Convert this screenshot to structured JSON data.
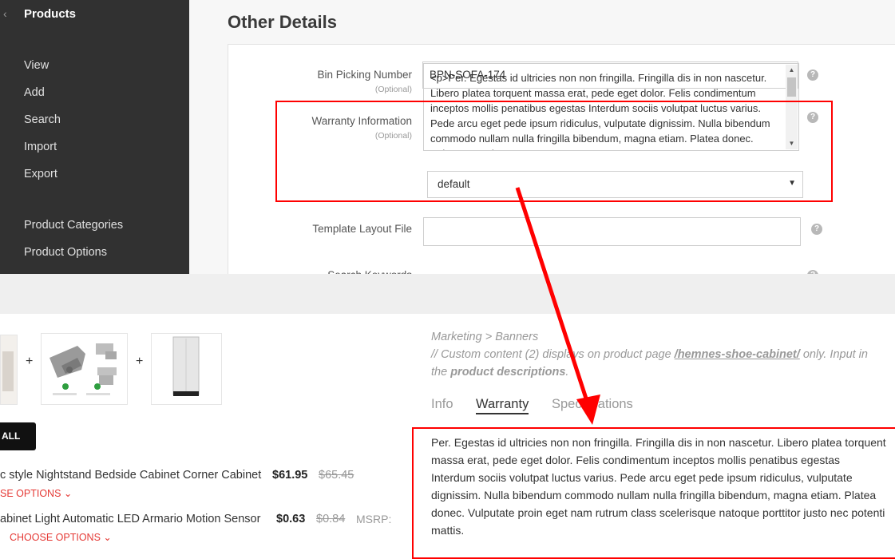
{
  "sidebar": {
    "back_icon": "chevron-left-icon",
    "title": "Products",
    "items": [
      {
        "label": "View"
      },
      {
        "label": "Add"
      },
      {
        "label": "Search"
      },
      {
        "label": "Import"
      },
      {
        "label": "Export"
      },
      {
        "label": "Product Categories"
      },
      {
        "label": "Product Options"
      }
    ]
  },
  "section": {
    "title": "Other Details"
  },
  "form": {
    "bin_picking": {
      "label": "Bin Picking Number",
      "optional": "(Optional)",
      "value": "BPN-SOFA-174",
      "help_icon": "question-circle-icon"
    },
    "warranty": {
      "label": "Warranty Information",
      "optional": "(Optional)",
      "value": "<p>Per. Egestas id ultricies non non fringilla. Fringilla dis in non nascetur. Libero platea torquent massa erat, pede eget dolor. Felis condimentum inceptos mollis penatibus egestas Interdum sociis volutpat luctus varius. Pede arcu eget pede ipsum ridiculus, vulputate dignissim. Nulla bibendum commodo nullam nulla fringilla bibendum, magna etiam. Platea donec. Vulputate proin eget",
      "help_icon": "question-circle-icon"
    },
    "template_layout": {
      "label": "Template Layout File",
      "value": "default",
      "help_icon": "question-circle-icon"
    },
    "search_keywords": {
      "label": "Search Keywords",
      "help_icon": "question-circle-icon"
    }
  },
  "store": {
    "add_all_label": "ALL",
    "products": [
      {
        "name": "c style Nightstand Bedside Cabinet Corner Cabinet",
        "price": "$61.95",
        "old_price": "$65.45",
        "msrp": "",
        "choose": "SE OPTIONS"
      },
      {
        "name": "abinet Light Automatic LED Armario Motion Sensor",
        "price": "$0.63",
        "old_price": "$0.84",
        "msrp": "MSRP:",
        "choose": "CHOOSE OPTIONS"
      }
    ],
    "note": {
      "line1": "Marketing > Banners",
      "line2_pre": "// Custom content (2) displays on product page",
      "line2_link": "/hemnes-shoe-cabinet/",
      "line2_post": "only. Input in",
      "line3_pre": "the",
      "line3_bold": "product descriptions",
      "line3_post": "."
    },
    "tabs": [
      {
        "label": "Info"
      },
      {
        "label": "Warranty"
      },
      {
        "label": "Specifications"
      }
    ],
    "warranty_text": "Per. Egestas id ultricies non non fringilla. Fringilla dis in non nascetur. Libero platea torquent massa erat, pede eget dolor. Felis condimentum inceptos mollis penatibus egestas Interdum sociis volutpat luctus varius. Pede arcu eget pede ipsum ridiculus, vulputate dignissim. Nulla bibendum commodo nullam nulla fringilla bibendum, magna etiam. Platea donec. Vulputate proin eget nam rutrum class scelerisque natoque porttitor justo nec potenti mattis."
  },
  "colors": {
    "sidebar_bg": "#313131",
    "highlight_red": "#ff0000",
    "choose_options_red": "#e53935"
  }
}
